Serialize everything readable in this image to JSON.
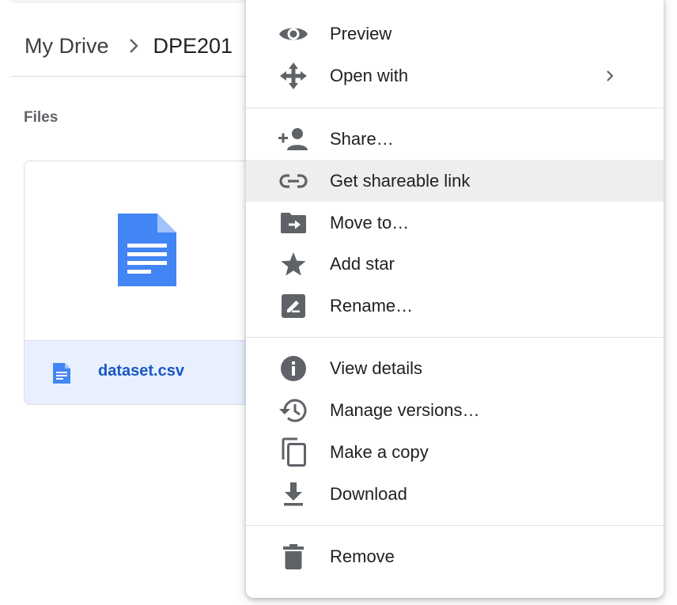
{
  "breadcrumb": {
    "root": "My Drive",
    "current": "DPE201"
  },
  "files_section": {
    "label": "Files",
    "items": [
      {
        "name": "dataset.csv",
        "icon": "document-icon"
      }
    ]
  },
  "context_menu": {
    "groups": [
      [
        {
          "label": "Preview",
          "icon": "eye-icon"
        },
        {
          "label": "Open with",
          "icon": "move-arrows-icon",
          "has_submenu": true
        }
      ],
      [
        {
          "label": "Share…",
          "icon": "add-person-icon"
        },
        {
          "label": "Get shareable link",
          "icon": "link-icon",
          "highlighted": true
        },
        {
          "label": "Move to…",
          "icon": "folder-move-icon"
        },
        {
          "label": "Add star",
          "icon": "star-icon"
        },
        {
          "label": "Rename…",
          "icon": "edit-icon"
        }
      ],
      [
        {
          "label": "View details",
          "icon": "info-icon"
        },
        {
          "label": "Manage versions…",
          "icon": "history-icon"
        },
        {
          "label": "Make a copy",
          "icon": "copy-icon"
        },
        {
          "label": "Download",
          "icon": "download-icon"
        }
      ],
      [
        {
          "label": "Remove",
          "icon": "trash-icon"
        }
      ]
    ]
  },
  "colors": {
    "accent": "#1a57c2",
    "doc_blue": "#4285f4",
    "selected_bg": "#e8f0fe",
    "highlight_bg": "#eeeeee",
    "icon_grey": "#5f6368"
  }
}
